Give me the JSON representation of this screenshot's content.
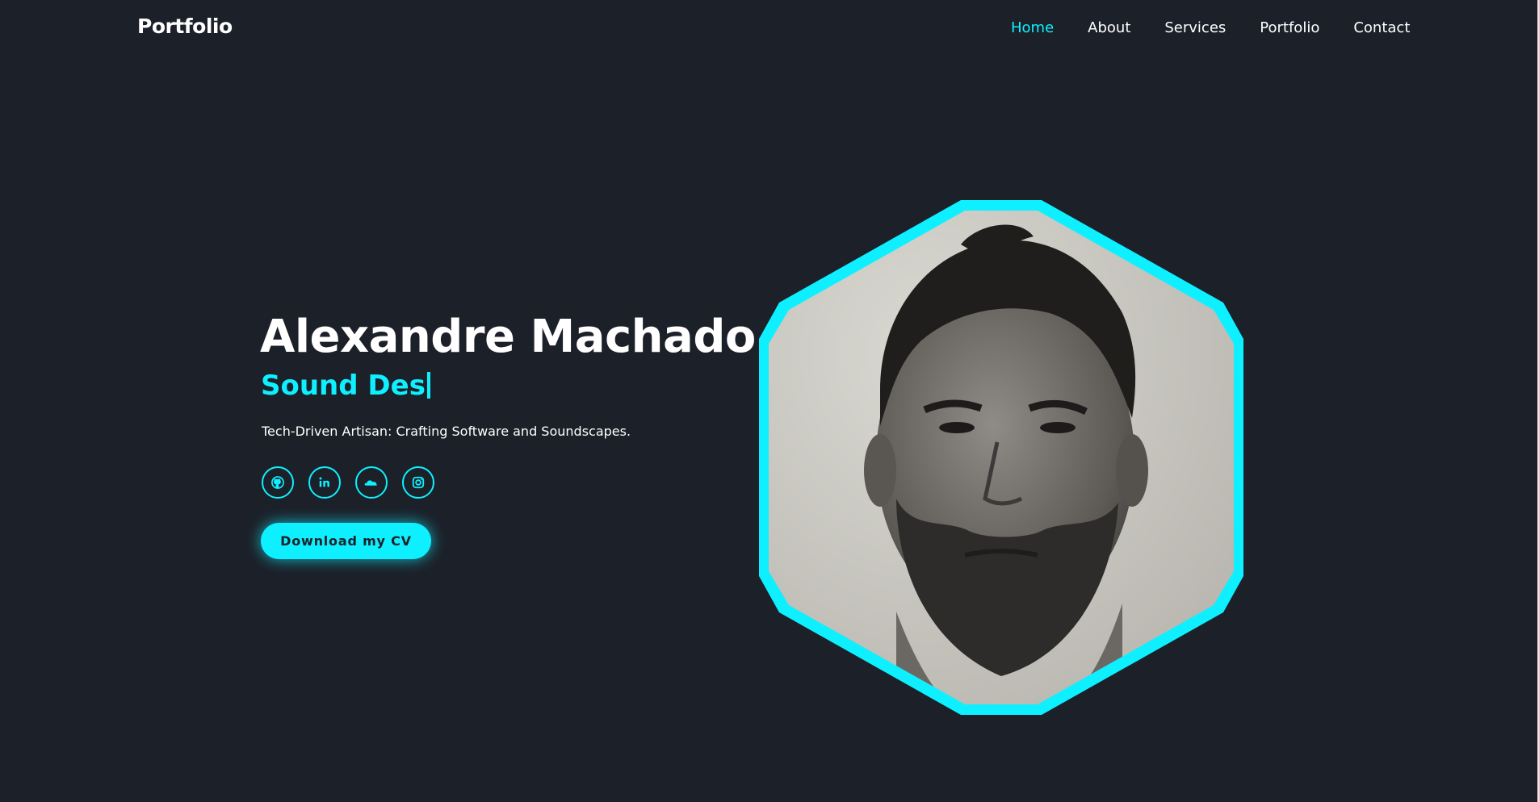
{
  "header": {
    "logo": "Portfolio",
    "nav": [
      {
        "label": "Home",
        "active": true
      },
      {
        "label": "About",
        "active": false
      },
      {
        "label": "Services",
        "active": false
      },
      {
        "label": "Portfolio",
        "active": false
      },
      {
        "label": "Contact",
        "active": false
      }
    ]
  },
  "hero": {
    "name": "Alexandre Machado",
    "role_typed": "Sound Des",
    "tagline": "Tech-Driven Artisan: Crafting Software and Soundscapes.",
    "socials": [
      {
        "icon": "github-icon"
      },
      {
        "icon": "linkedin-icon"
      },
      {
        "icon": "soundcloud-icon"
      },
      {
        "icon": "instagram-icon"
      }
    ],
    "cta_label": "Download my CV",
    "portrait_alt": "profile-photo"
  },
  "colors": {
    "background": "#1c2029",
    "accent": "#0ef0ff",
    "text": "#ffffff"
  }
}
